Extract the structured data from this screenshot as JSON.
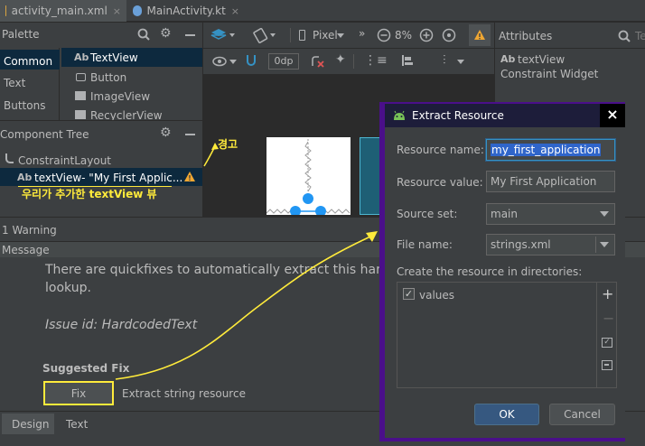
{
  "tabs": [
    {
      "label": "activity_main.xml",
      "close": "×"
    },
    {
      "label": "MainActivity.kt",
      "close": "×"
    }
  ],
  "palette": {
    "title": "Palette",
    "categories": [
      "Common",
      "Text",
      "Buttons"
    ],
    "items": [
      {
        "icon_text": "Ab",
        "label": "TextView"
      },
      {
        "label": "Button"
      },
      {
        "label": "ImageView"
      },
      {
        "label": "RecyclerView"
      }
    ]
  },
  "toolbar": {
    "device": "Pixel",
    "zoom": "8%",
    "margin": "0dp",
    "more": "»"
  },
  "attributes": {
    "title": "Attributes",
    "component_icon": "Ab",
    "component": "textView",
    "type": "Constraint Widget",
    "tab_partial": "Te"
  },
  "component_tree": {
    "title": "Component Tree",
    "root": "ConstraintLayout",
    "child_icon": "Ab",
    "child": "textView- \"My First Applic...",
    "warning_icon": "!"
  },
  "annotations": {
    "warning_ko": "경고",
    "textview_ko": "우리가 추가한 textView 뷰"
  },
  "warnings": {
    "count_label": "1 Warning",
    "message_header": "Message",
    "body_line1": "There are quickfixes to automatically extract this hardcoded",
    "body_line2": "lookup.",
    "issue": "Issue id: HardcodedText",
    "suggested_fix": "Suggested Fix",
    "fix_button": "Fix",
    "fix_description": "Extract string resource"
  },
  "bottom_tabs": [
    "Design",
    "Text"
  ],
  "dialog": {
    "title": "Extract Resource",
    "close": "×",
    "resource_name_label": "Resource name:",
    "resource_name_value": "my_first_application",
    "resource_value_label": "Resource value:",
    "resource_value_value": "My First Application",
    "source_set_label": "Source set:",
    "source_set_value": "main",
    "file_name_label": "File name:",
    "file_name_value": "strings.xml",
    "directories_label": "Create the resource in directories:",
    "directories": [
      {
        "name": "values",
        "checked": true
      }
    ],
    "side_buttons": {
      "add": "+",
      "remove": "−"
    },
    "ok": "OK",
    "cancel": "Cancel"
  },
  "colors": {
    "accent_yellow": "#ffeb3b",
    "selection": "#0d293e",
    "dialog_border": "#4a0f8a",
    "blueprint_blue": "#2196f3",
    "ok_button": "#365880"
  }
}
